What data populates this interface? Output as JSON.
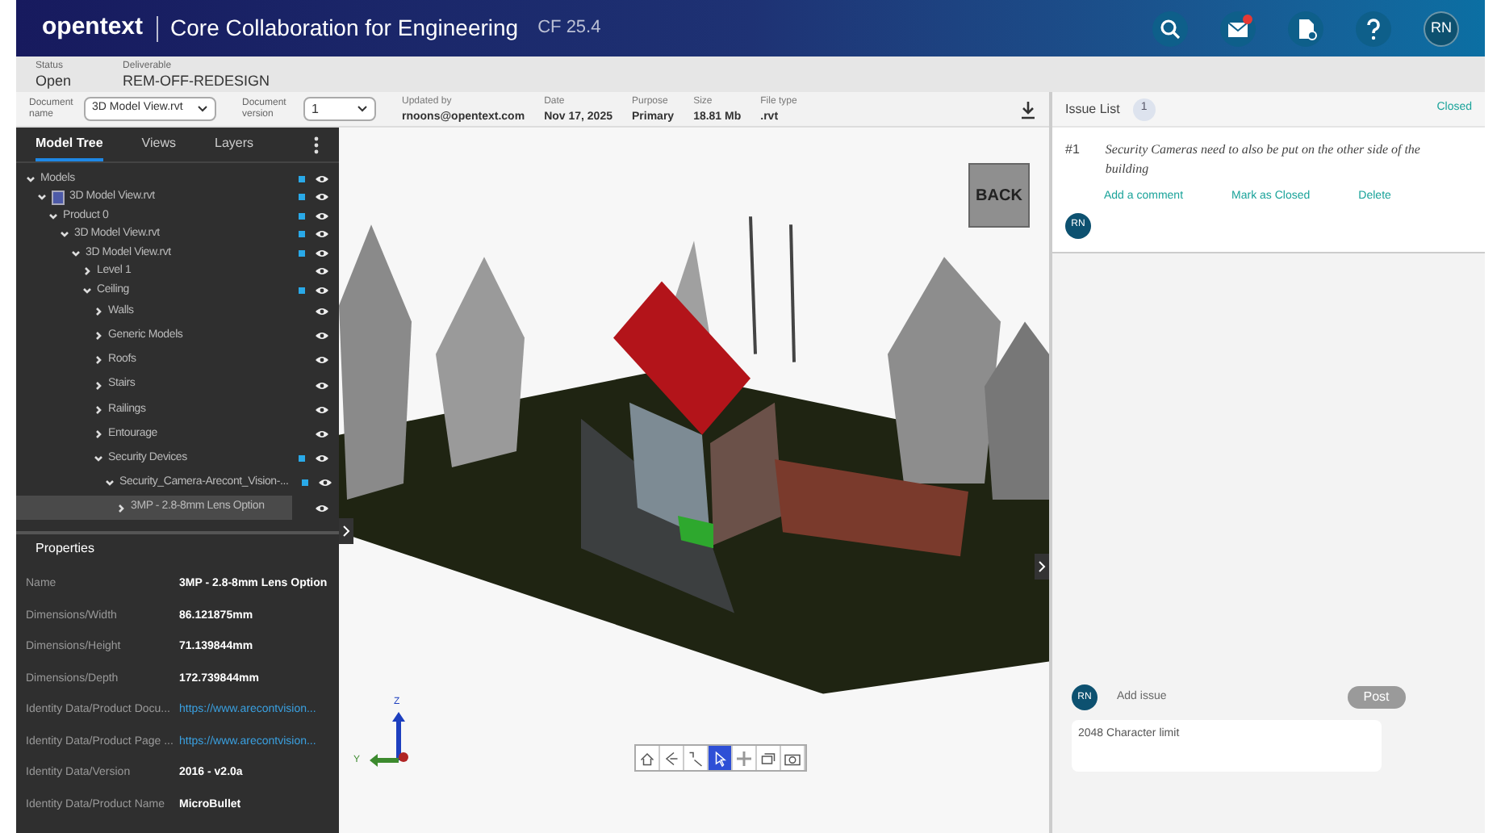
{
  "header": {
    "logo": "opentext",
    "app_title": "Core Collaboration for Engineering",
    "version": "CF 25.4",
    "avatar": "RN"
  },
  "info_bar": [
    {
      "label": "Status",
      "value": "Open"
    },
    {
      "label": "Deliverable",
      "value": "REM-OFF-REDESIGN"
    }
  ],
  "document_bar": {
    "name_label": "Document name",
    "name_value": "3D Model View.rvt",
    "version_label": "Document version",
    "version_value": "1",
    "meta": [
      {
        "label": "Updated by",
        "value": "rnoons@opentext.com"
      },
      {
        "label": "Date",
        "value": "Nov 17, 2025"
      },
      {
        "label": "Purpose",
        "value": "Primary"
      },
      {
        "label": "Size",
        "value": "18.81 Mb"
      },
      {
        "label": "File type",
        "value": ".rvt"
      }
    ]
  },
  "left_panel": {
    "tabs": [
      {
        "label": "Model Tree",
        "selected": true
      },
      {
        "label": "Views",
        "selected": false
      },
      {
        "label": "Layers",
        "selected": false
      }
    ],
    "tree": [
      {
        "label": "Models",
        "expanded": true,
        "active": true,
        "selected": false,
        "children": [
          {
            "label": "3D Model View.rvt",
            "kind": "file",
            "expanded": true,
            "active": true,
            "selected": false,
            "children": [
              {
                "label": "Product 0",
                "expanded": true,
                "active": true,
                "selected": false,
                "children": [
                  {
                    "label": "3D Model View.rvt",
                    "expanded": true,
                    "active": true,
                    "selected": false,
                    "children": [
                      {
                        "label": "3D Model View.rvt",
                        "expanded": true,
                        "active": true,
                        "selected": false,
                        "children": [
                          {
                            "label": "Level 1",
                            "expanded": false,
                            "active": false,
                            "selected": false
                          },
                          {
                            "label": "Ceiling",
                            "expanded": true,
                            "active": true,
                            "selected": false,
                            "children": [
                              {
                                "label": "Walls",
                                "expanded": false,
                                "active": false,
                                "selected": false
                              },
                              {
                                "label": "Generic Models",
                                "expanded": false,
                                "active": false,
                                "selected": false
                              },
                              {
                                "label": "Roofs",
                                "expanded": false,
                                "active": false,
                                "selected": false
                              },
                              {
                                "label": "Stairs",
                                "expanded": false,
                                "active": false,
                                "selected": false
                              },
                              {
                                "label": "Railings",
                                "expanded": false,
                                "active": false,
                                "selected": false
                              },
                              {
                                "label": "Entourage",
                                "expanded": false,
                                "active": false,
                                "selected": false
                              },
                              {
                                "label": "Security Devices",
                                "expanded": true,
                                "active": true,
                                "selected": false,
                                "children": [
                                  {
                                    "label": "Security_Camera-Arecont_Vision-...",
                                    "expanded": true,
                                    "active": true,
                                    "selected": false,
                                    "children": [
                                      {
                                        "label": "3MP - 2.8-8mm Lens Option",
                                        "expanded": false,
                                        "active": false,
                                        "selected": true
                                      }
                                    ]
                                  }
                                ]
                              }
                            ]
                          }
                        ]
                      }
                    ]
                  }
                ]
              }
            ]
          }
        ]
      }
    ],
    "properties_title": "Properties",
    "properties": [
      {
        "name": "Name",
        "value": "3MP - 2.8-8mm Lens Option",
        "kind": "text"
      },
      {
        "name": "Dimensions/Width",
        "value": "86.121875mm",
        "kind": "text"
      },
      {
        "name": "Dimensions/Height",
        "value": "71.139844mm",
        "kind": "text"
      },
      {
        "name": "Dimensions/Depth",
        "value": "172.739844mm",
        "kind": "text"
      },
      {
        "name": "Identity Data/Product Docu...",
        "value": "https://www.arecontvision...",
        "kind": "link"
      },
      {
        "name": "Identity Data/Product Page ...",
        "value": "https://www.arecontvision...",
        "kind": "link"
      },
      {
        "name": "Identity Data/Version",
        "value": "2016 - v2.0a",
        "kind": "text"
      },
      {
        "name": "Identity Data/Product Name",
        "value": "MicroBullet",
        "kind": "text"
      }
    ]
  },
  "viewer": {
    "kind": "picture",
    "view_cube": "BACK",
    "axes": [
      "Z",
      "Y"
    ],
    "tools": [
      {
        "kind": "home",
        "selected": false
      },
      {
        "kind": "walk",
        "selected": false
      },
      {
        "kind": "measure",
        "selected": false
      },
      {
        "kind": "select",
        "selected": true
      },
      {
        "kind": "pan",
        "selected": false
      },
      {
        "kind": "section",
        "selected": false
      },
      {
        "kind": "camera",
        "selected": false
      }
    ]
  },
  "issue_panel": {
    "title": "Issue List",
    "count": "1",
    "closed_link": "Closed",
    "issues": [
      {
        "number": "#1",
        "text": "Security Cameras need to also be put on the other side of the building",
        "actions": [
          "Add a comment",
          "Mark as Closed",
          "Delete"
        ],
        "avatar": "RN"
      }
    ],
    "new_issue": {
      "avatar": "RN",
      "label": "Add issue",
      "post": "Post",
      "placeholder": "2048 Character limit"
    }
  }
}
